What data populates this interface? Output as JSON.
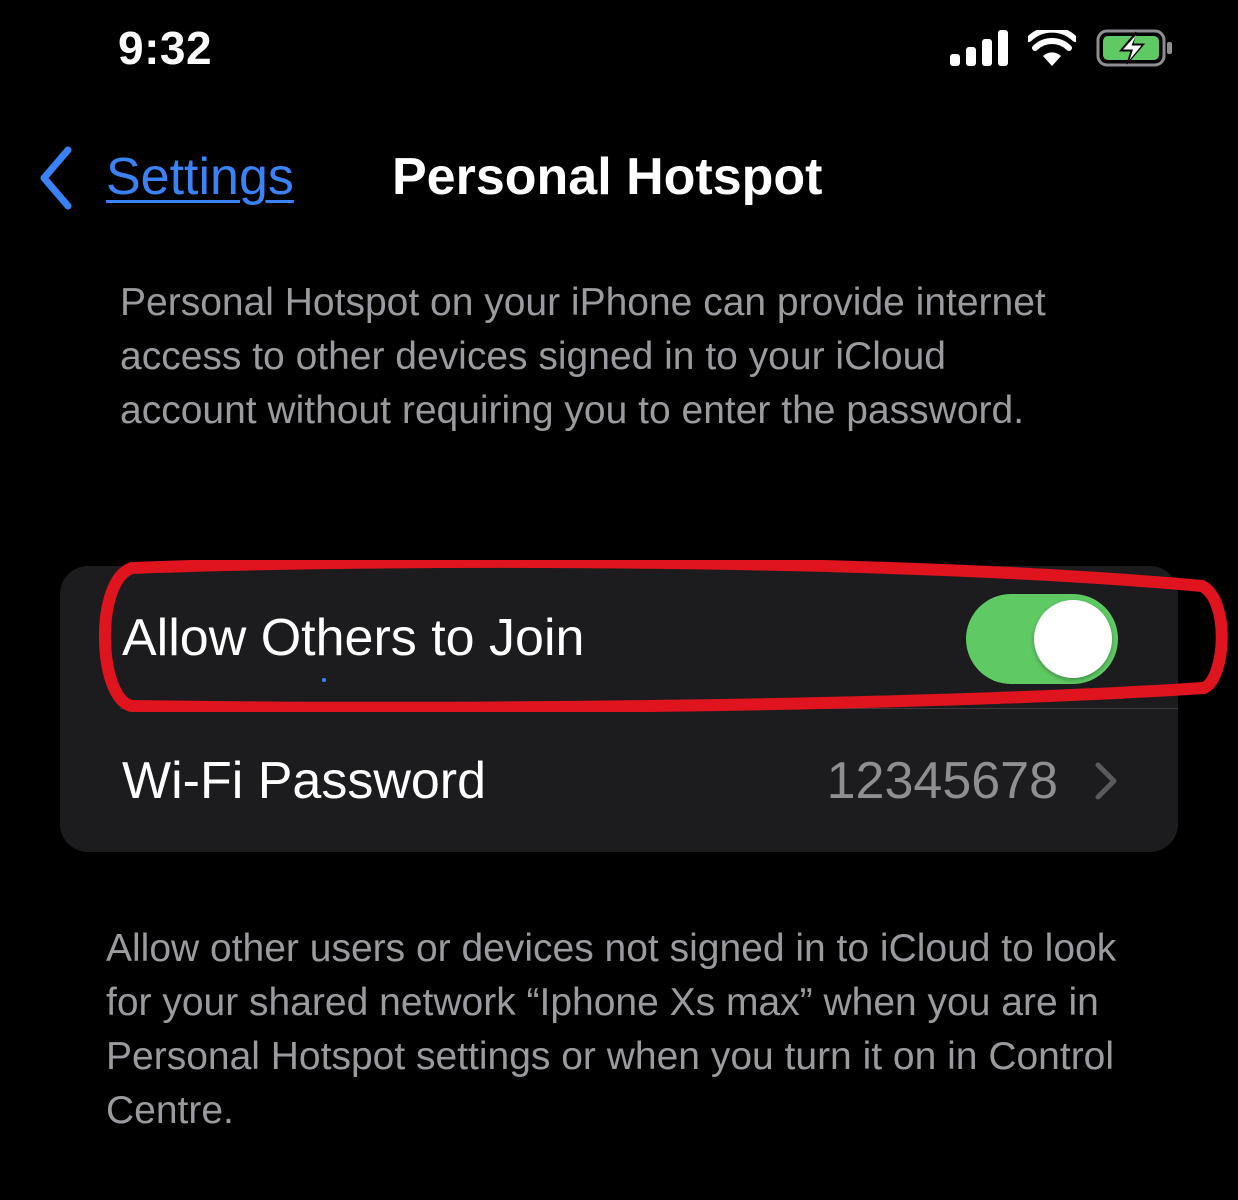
{
  "status_bar": {
    "time": "9:32",
    "icons": [
      "cellular-signal-icon",
      "wifi-icon",
      "battery-charging-icon"
    ],
    "battery_color": "#5fc964"
  },
  "nav": {
    "back_label": "Settings",
    "title": "Personal Hotspot",
    "accent_color": "#3a82f7"
  },
  "header_description": "Personal Hotspot on your iPhone can provide internet access to other devices signed in to your iCloud account without requiring you to enter the password.",
  "settings": {
    "allow_others": {
      "label": "Allow Others to Join",
      "enabled": true,
      "toggle_color": "#5fc964"
    },
    "wifi_password": {
      "label": "Wi-Fi Password",
      "value": "12345678"
    }
  },
  "footer_description": "Allow other users or devices not signed in to iCloud to look for your shared network “Iphone Xs max” when you are in Personal Hotspot settings or when you turn it on in Control Centre.",
  "annotation": {
    "highlight_color": "#e0141e"
  }
}
